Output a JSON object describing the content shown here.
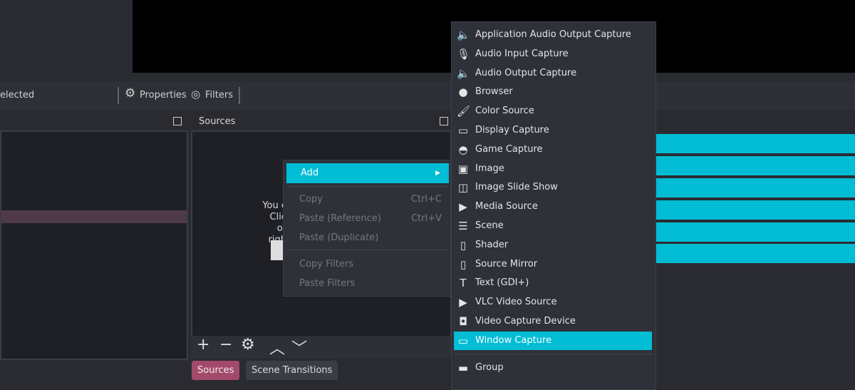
{
  "toolbar": {
    "selected_text": "elected",
    "properties": "Properties",
    "filters": "Filters"
  },
  "sources_dock": {
    "title": "Sources",
    "empty_hint": [
      "You c",
      "Clic",
      "or righ"
    ]
  },
  "context_menu": {
    "add": "Add",
    "items": [
      {
        "label": "Copy",
        "shortcut": "Ctrl+C"
      },
      {
        "label": "Paste (Reference)",
        "shortcut": "Ctrl+V"
      },
      {
        "label": "Paste (Duplicate)",
        "shortcut": ""
      },
      {
        "label": "Copy Filters",
        "shortcut": ""
      },
      {
        "label": "Paste Filters",
        "shortcut": ""
      }
    ]
  },
  "add_submenu": [
    {
      "label": "Application Audio Output Capture",
      "icon": "speaker-icon"
    },
    {
      "label": "Audio Input Capture",
      "icon": "microphone-icon"
    },
    {
      "label": "Audio Output Capture",
      "icon": "speaker-icon"
    },
    {
      "label": "Browser",
      "icon": "globe-icon"
    },
    {
      "label": "Color Source",
      "icon": "brush-icon"
    },
    {
      "label": "Display Capture",
      "icon": "monitor-icon"
    },
    {
      "label": "Game Capture",
      "icon": "gamepad-icon"
    },
    {
      "label": "Image",
      "icon": "image-icon"
    },
    {
      "label": "Image Slide Show",
      "icon": "slideshow-icon"
    },
    {
      "label": "Media Source",
      "icon": "play-icon"
    },
    {
      "label": "Scene",
      "icon": "list-icon"
    },
    {
      "label": "Shader",
      "icon": "file-icon"
    },
    {
      "label": "Source Mirror",
      "icon": "file-icon"
    },
    {
      "label": "Text (GDI+)",
      "icon": "text-icon"
    },
    {
      "label": "VLC Video Source",
      "icon": "play-icon"
    },
    {
      "label": "Video Capture Device",
      "icon": "camera-icon"
    },
    {
      "label": "Window Capture",
      "icon": "window-icon",
      "highlighted": true
    },
    {
      "label": "Group",
      "icon": "folder-icon"
    }
  ],
  "bottom_tabs": {
    "sources": "Sources",
    "transitions": "Scene Transitions"
  },
  "colors": {
    "accent": "#00bcd4",
    "active_tab": "#a34a6a",
    "selected_row": "#4f3a47"
  }
}
